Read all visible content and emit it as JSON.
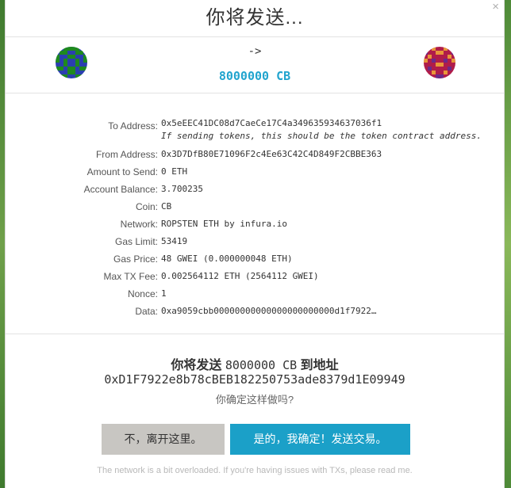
{
  "modal": {
    "title": "你将发送...",
    "close_icon": "×",
    "arrow": "->",
    "amount": "8000000 CB"
  },
  "details": [
    {
      "label": "To Address:",
      "value": "0x5eEEC41DC08d7CaeCe17C4a349635934637036f1",
      "note": "If sending tokens, this should be the token contract address."
    },
    {
      "label": "From Address:",
      "value": "0x3D7DfB80E71096F2c4Ee63C42C4D849F2CBBE363"
    },
    {
      "label": "Amount to Send:",
      "value": "0 ETH"
    },
    {
      "label": "Account Balance:",
      "value": "3.700235"
    },
    {
      "label": "Coin:",
      "value": "CB"
    },
    {
      "label": "Network:",
      "value": "ROPSTEN ETH by infura.io"
    },
    {
      "label": "Gas Limit:",
      "value": "53419"
    },
    {
      "label": "Gas Price:",
      "value": "48 GWEI (0.000000048 ETH)"
    },
    {
      "label": "Max TX Fee:",
      "value": "0.002564112 ETH (2564112 GWEI)"
    },
    {
      "label": "Nonce:",
      "value": "1"
    },
    {
      "label": "Data:",
      "value": "0xa9059cbb00000000000000000000000d1f7922…"
    }
  ],
  "confirm": {
    "prefix": "你将发送",
    "amount": "8000000 CB",
    "suffix": "到地址",
    "address": "0xD1F7922e8b78cBEB182250753ade8379d1E09949",
    "question": "你确定这样做吗?"
  },
  "buttons": {
    "no": "不，离开这里。",
    "yes": "是的，我确定！发送交易。"
  },
  "footer": "The network is a bit overloaded. If you're having issues with TXs, please read me.",
  "colors": {
    "accent": "#1ba0c8",
    "amount": "#21a4ce",
    "secondary_button": "#c8c6c2"
  }
}
